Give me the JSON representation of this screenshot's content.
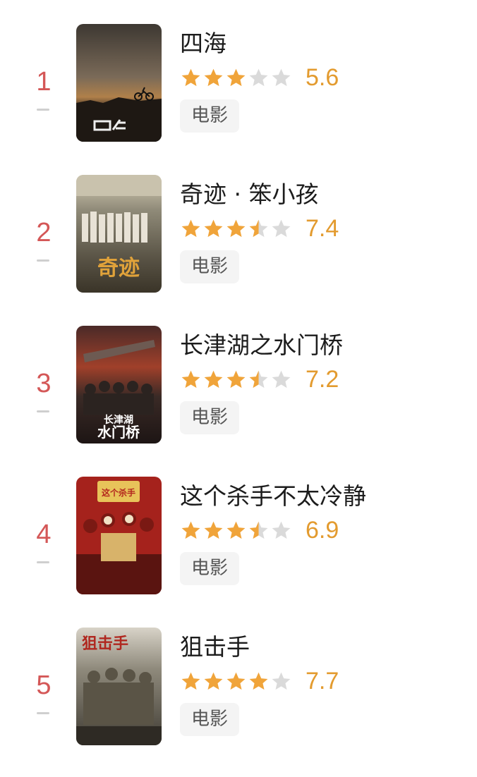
{
  "colors": {
    "rank": "#d45757",
    "star_filled": "#f0a43a",
    "star_empty": "#dadada",
    "score": "#e39b2f",
    "tag_bg": "#f4f4f4"
  },
  "movies": [
    {
      "rank": "1",
      "title": "四海",
      "score": "5.6",
      "stars": 3,
      "tag": "电影",
      "poster_icon": "poster-sihai-image"
    },
    {
      "rank": "2",
      "title": "奇迹 · 笨小孩",
      "score": "7.4",
      "stars": 3.5,
      "tag": "电影",
      "poster_icon": "poster-qiji-image"
    },
    {
      "rank": "3",
      "title": "长津湖之水门桥",
      "score": "7.2",
      "stars": 3.5,
      "tag": "电影",
      "poster_icon": "poster-shuimenqiao-image"
    },
    {
      "rank": "4",
      "title": "这个杀手不太冷静",
      "score": "6.9",
      "stars": 3.5,
      "tag": "电影",
      "poster_icon": "poster-shashou-image"
    },
    {
      "rank": "5",
      "title": "狙击手",
      "score": "7.7",
      "stars": 4,
      "tag": "电影",
      "poster_icon": "poster-jujishou-image"
    }
  ]
}
